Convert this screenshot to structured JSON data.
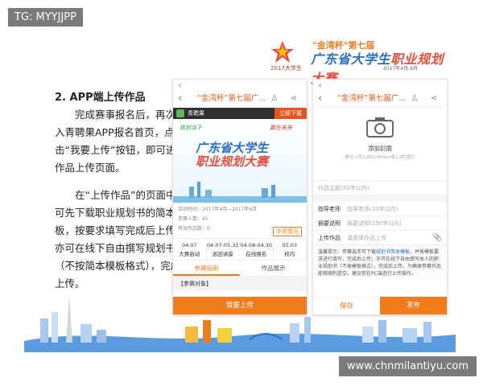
{
  "tag": "TG: MYYJJPP",
  "watermark": "www.chnmilantiyu.com",
  "banner": {
    "logo_caption": "2017大学生",
    "quote": "\"金湾杯\"第七届",
    "title_a": "广东省大学生",
    "title_b": "职业规划大赛",
    "date": "2017年4月-6月"
  },
  "section_title": "2. APP端上传作品",
  "para1": "完成赛事报名后，再次进入青聘果APP报名首页，点击“我要上传”按钮，即可进入作品上传页面。",
  "para2": "在“上传作品”的页面中，可先下载职业规划书的简本模板，按要求填写完成后上传；亦可在线下自由撰写规划书（不按简本模板格式），完成后上传。",
  "phone1": {
    "back": "‹",
    "nav_title": "“金湾杯”第七届广...",
    "icons": "♙ ⋖",
    "app_name": "青聘果",
    "download": "立即下载",
    "poster_left": "规划当下",
    "poster_right": "赢在未来",
    "poster_title_a": "广东省大学生",
    "poster_title_b": "职业规划大赛",
    "info_time": "活动时间：2017年4月—2017年6月",
    "info_count": "参赛人数：45",
    "info_works": "有效作品数：0",
    "tag_btn": "中奖情况",
    "timeline": [
      {
        "date": "04.07",
        "label": "大赛启动"
      },
      {
        "date": "04.07-05.31",
        "label": "巡回讲座"
      },
      {
        "date": "04.08-04.30",
        "label": "在线报名"
      },
      {
        "date": "05.03",
        "label": "校内"
      }
    ],
    "tabs": [
      "参赛指南",
      "作品展示"
    ],
    "section": "【参赛对象】",
    "button": "我要上传"
  },
  "phone2": {
    "back": "‹",
    "nav_title": "“金湾杯”第七届广...",
    "icons": "♙ ⋖",
    "cover_label": "添加封面",
    "cover_hint": "建议上传1280x960px或1:2的图片",
    "fields": [
      {
        "key": "",
        "placeholder": "作品主题(50字以内)"
      },
      {
        "key": "指导老师",
        "placeholder": "指导老师(10字以内)"
      },
      {
        "key": "摘要说明",
        "placeholder": "摘要说明(150字以内)"
      },
      {
        "key": "上传作品",
        "placeholder": "请选择作品上传"
      }
    ],
    "notice_a": "温馨提示：参赛选手可下载",
    "notice_link": "规划书简本模板",
    "notice_b": "，并按模板要求进行填写，完成后上传；亦可在线下自由撰写本人的职业规划书（不按模板格式），完成后上传。为确保参赛作品能够顺利提交，建议你在PC端进行上传操作。",
    "save": "保存",
    "publish": "发布"
  },
  "colors": {
    "accent": "#f07c1c",
    "brand_blue": "#2c6fc2",
    "brand_red": "#e74c3c"
  }
}
